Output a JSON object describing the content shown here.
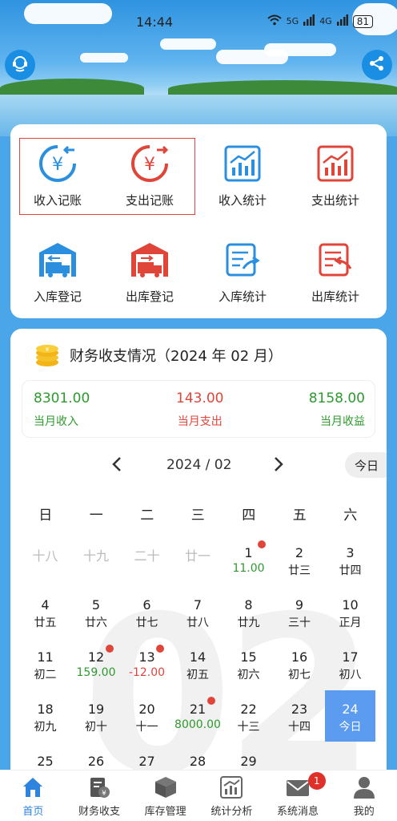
{
  "status": {
    "time": "14:44",
    "signal1": "5G",
    "signal2": "4G",
    "battery": "81"
  },
  "menu": [
    {
      "label": "收入记账",
      "icon": "income-record-icon",
      "color": "#2b8fe0"
    },
    {
      "label": "支出记账",
      "icon": "expense-record-icon",
      "color": "#e0453a"
    },
    {
      "label": "收入统计",
      "icon": "income-stats-icon",
      "color": "#2b8fe0"
    },
    {
      "label": "支出统计",
      "icon": "expense-stats-icon",
      "color": "#e0453a"
    },
    {
      "label": "入库登记",
      "icon": "warehouse-in-icon",
      "color": "#2b8fe0"
    },
    {
      "label": "出库登记",
      "icon": "warehouse-out-icon",
      "color": "#e0453a"
    },
    {
      "label": "入库统计",
      "icon": "in-stats-icon",
      "color": "#2b8fe0"
    },
    {
      "label": "出库统计",
      "icon": "out-stats-icon",
      "color": "#e0453a"
    }
  ],
  "finance": {
    "title": "财务收支情况（2024 年 02 月）",
    "income_value": "8301.00",
    "income_label": "当月收入",
    "expense_value": "143.00",
    "expense_label": "当月支出",
    "profit_value": "8158.00",
    "profit_label": "当月收益"
  },
  "calendar": {
    "month_label": "2024 / 02",
    "today_label": "今日",
    "watermark": "02",
    "weekdays": [
      "日",
      "一",
      "二",
      "三",
      "四",
      "五",
      "六"
    ],
    "rows": [
      [
        {
          "n": "十八",
          "muted": true
        },
        {
          "n": "十九",
          "muted": true
        },
        {
          "n": "二十",
          "muted": true
        },
        {
          "n": "廿一",
          "muted": true
        },
        {
          "n": "1",
          "s": "11.00",
          "sc": "green",
          "dot": true
        },
        {
          "n": "2",
          "s": "廿三"
        },
        {
          "n": "3",
          "s": "廿四"
        }
      ],
      [
        {
          "n": "4",
          "s": "廿五"
        },
        {
          "n": "5",
          "s": "廿六"
        },
        {
          "n": "6",
          "s": "廿七"
        },
        {
          "n": "7",
          "s": "廿八"
        },
        {
          "n": "8",
          "s": "廿九"
        },
        {
          "n": "9",
          "s": "三十"
        },
        {
          "n": "10",
          "s": "正月"
        }
      ],
      [
        {
          "n": "11",
          "s": "初二"
        },
        {
          "n": "12",
          "s": "159.00",
          "sc": "green",
          "dot": true
        },
        {
          "n": "13",
          "s": "-12.00",
          "sc": "red",
          "dot": true
        },
        {
          "n": "14",
          "s": "初五"
        },
        {
          "n": "15",
          "s": "初六"
        },
        {
          "n": "16",
          "s": "初七"
        },
        {
          "n": "17",
          "s": "初八"
        }
      ],
      [
        {
          "n": "18",
          "s": "初九"
        },
        {
          "n": "19",
          "s": "初十"
        },
        {
          "n": "20",
          "s": "十一"
        },
        {
          "n": "21",
          "s": "8000.00",
          "sc": "green",
          "dot": true
        },
        {
          "n": "22",
          "s": "十三"
        },
        {
          "n": "23",
          "s": "十四"
        },
        {
          "n": "24",
          "s": "今日",
          "today": true
        }
      ],
      [
        {
          "n": "25"
        },
        {
          "n": "26"
        },
        {
          "n": "27"
        },
        {
          "n": "28"
        },
        {
          "n": "29"
        },
        {
          "n": ""
        },
        {
          "n": ""
        }
      ]
    ]
  },
  "tabs": [
    {
      "label": "首页",
      "icon": "home-icon",
      "active": true
    },
    {
      "label": "财务收支",
      "icon": "finance-icon"
    },
    {
      "label": "库存管理",
      "icon": "box-icon"
    },
    {
      "label": "统计分析",
      "icon": "chart-icon"
    },
    {
      "label": "系统消息",
      "icon": "mail-icon",
      "badge": "1"
    },
    {
      "label": "我的",
      "icon": "user-icon"
    }
  ]
}
